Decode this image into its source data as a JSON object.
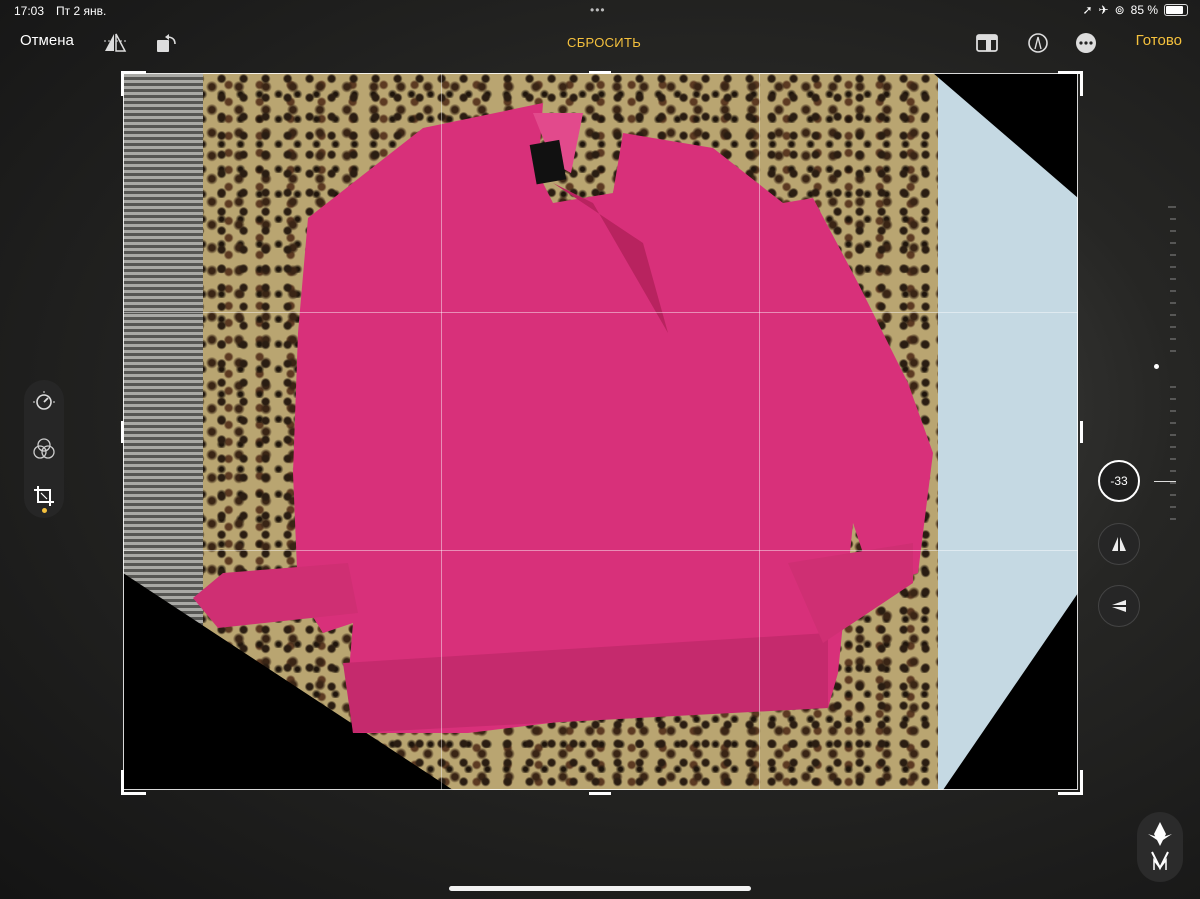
{
  "status": {
    "time": "17:03",
    "date": "Пт 2 янв.",
    "multitask": "•••",
    "battery": "85 %"
  },
  "toolbar": {
    "cancel_label": "Отмена",
    "reset_label": "СБРОСИТЬ",
    "done_label": "Готово"
  },
  "straighten": {
    "value": "-33"
  },
  "colors": {
    "accent": "#f5c13d",
    "sweater": "#e2357f",
    "wall": "#c5d9e3"
  },
  "icons": [
    "flip-horizontal-icon",
    "rotate-icon",
    "aspect-ratio-icon",
    "markup-icon",
    "more-icon",
    "adjust-icon",
    "filters-icon",
    "crop-icon",
    "vertical-perspective-icon",
    "horizontal-perspective-icon"
  ]
}
